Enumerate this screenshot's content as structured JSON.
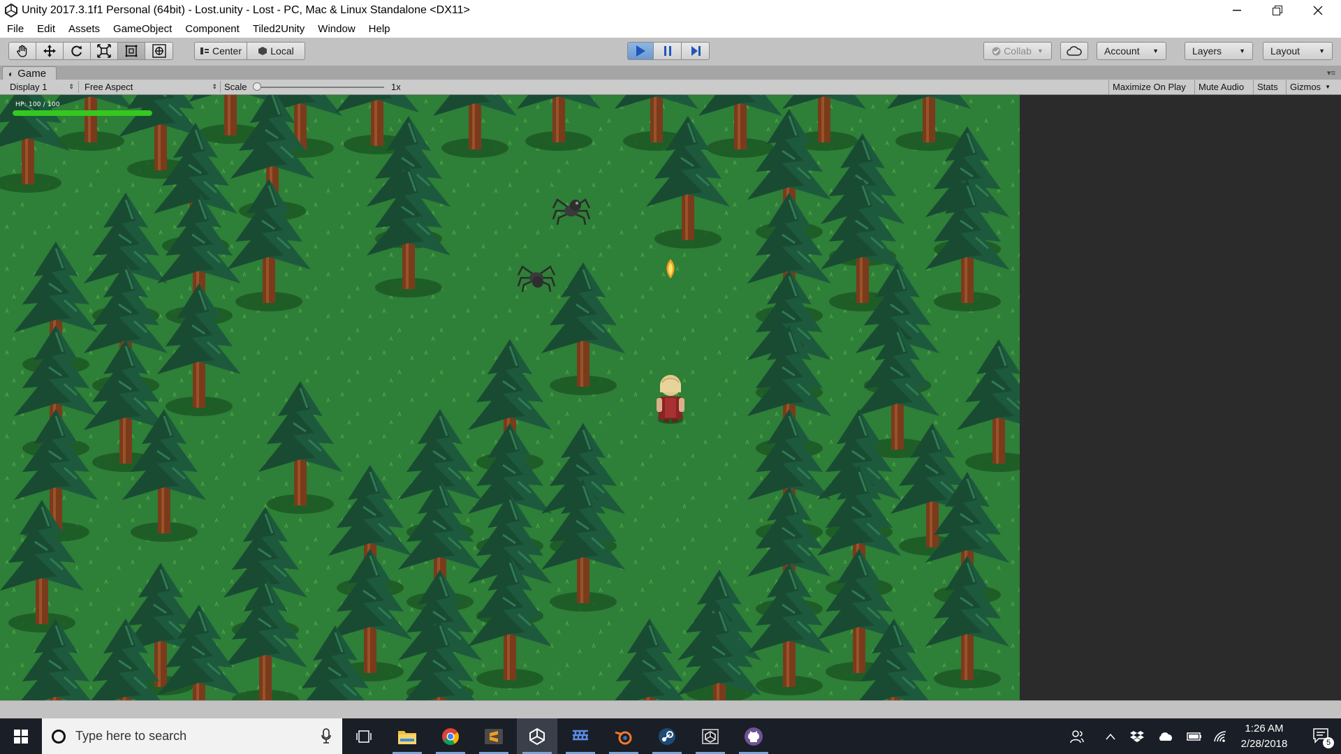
{
  "window": {
    "title": "Unity 2017.3.1f1 Personal (64bit) - Lost.unity - Lost - PC, Mac & Linux Standalone <DX11>"
  },
  "menu": [
    "File",
    "Edit",
    "Assets",
    "GameObject",
    "Component",
    "Tiled2Unity",
    "Window",
    "Help"
  ],
  "toolbar": {
    "tools": [
      "hand-icon",
      "move-icon",
      "rotate-icon",
      "scale-icon",
      "rect-tool-icon",
      "transform-tool-icon"
    ],
    "selected_tool": "rect-tool-icon",
    "pivot_label": "Center",
    "space_label": "Local",
    "play_state": "playing",
    "collab_label": "Collab",
    "account_label": "Account",
    "layers_label": "Layers",
    "layout_label": "Layout"
  },
  "game_panel": {
    "tab_label": "Game",
    "display": "Display 1",
    "aspect": "Free Aspect",
    "scale_label": "Scale",
    "scale_value": "1x",
    "toggles": [
      "Maximize On Play",
      "Mute Audio",
      "Stats",
      "Gizmos"
    ]
  },
  "hud": {
    "hp_label": "HP: 100 / 100",
    "hp_fraction": 1.0,
    "hp_color": "#35c81f"
  },
  "taskbar": {
    "search_placeholder": "Type here to search",
    "apps": [
      "task-view-icon",
      "file-explorer-icon",
      "chrome-icon",
      "sublime-text-icon",
      "unity-icon",
      "tiled-icon",
      "blender-icon",
      "steam-icon",
      "unity-hub-icon",
      "github-icon"
    ],
    "time": "1:26 AM",
    "date": "2/28/2018",
    "notification_count": "5"
  },
  "colors": {
    "grass": "#2d7d36",
    "tree_foliage": "#1f5a3c",
    "trunk": "#7a3b1c"
  }
}
